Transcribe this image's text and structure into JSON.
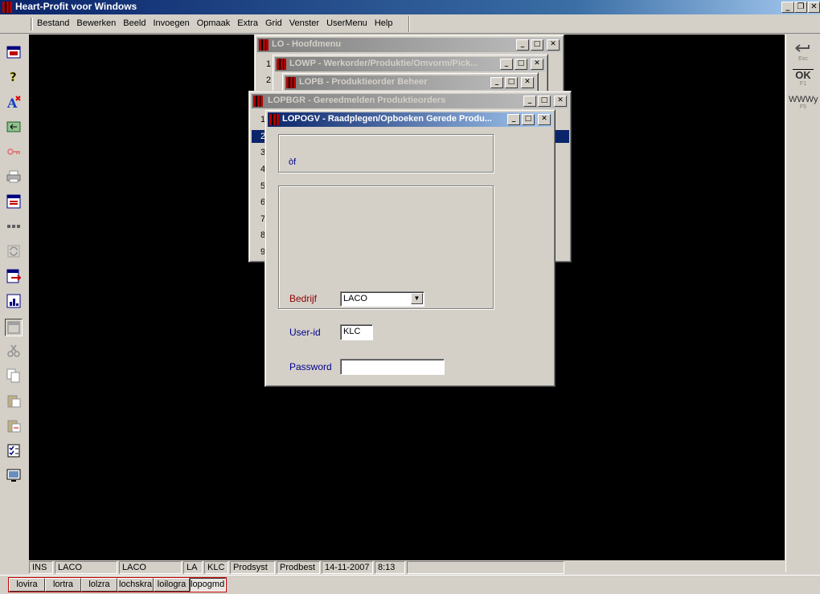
{
  "app": {
    "title": "Heart-Profit voor Windows"
  },
  "menu": [
    "Bestand",
    "Bewerken",
    "Beeld",
    "Invoegen",
    "Opmaak",
    "Extra",
    "Grid",
    "Venster",
    "UserMenu",
    "Help"
  ],
  "left_toolbar": {
    "icons": [
      "window-icon",
      "help-icon",
      "font-icon",
      "refresh-icon",
      "key-icon",
      "print-icon",
      "form-icon",
      "dots-icon",
      "sync-icon",
      "export-icon",
      "chart-icon",
      "panel-icon",
      "cut-icon",
      "copy-icon",
      "paste-icon",
      "paste-special-icon",
      "checklist-icon",
      "monitor-icon"
    ]
  },
  "right_toolbar": {
    "esc": {
      "label": "Esc",
      "icon": "back-arrow-icon"
    },
    "ok": {
      "label": "OK",
      "key": "F1"
    },
    "www": {
      "label": "WWWy",
      "key": "F5"
    }
  },
  "windows": {
    "hoofdmenu": {
      "title": "LO - Hoofdmenu",
      "rows": [
        "1",
        "2"
      ]
    },
    "lowp": {
      "title": "LOWP - Werkorder/Produktie/Omvorm/Pick..."
    },
    "lopb": {
      "title": "LOPB - Produktieorder Beheer"
    },
    "lopbgr": {
      "title": "LOPBGR - Gereedmelden Produktieorders",
      "rows": [
        "1",
        "2",
        "3",
        "4",
        "5",
        "6",
        "7",
        "8",
        "9"
      ]
    },
    "lopogv": {
      "title": "LOPOGV - Raadplegen/Opboeken Gerede Produ...",
      "header_text": "òf",
      "company_label": "Bedrijf",
      "company_value": "LACO",
      "userid_label": "User-id",
      "userid_value": "KLC",
      "password_label": "Password",
      "password_value": ""
    }
  },
  "statusbar": [
    "INS",
    "LACO",
    "LACO",
    "LA",
    "KLC",
    "Prodsyst",
    "Prodbest",
    "14-11-2007",
    "8:13",
    ""
  ],
  "taskbar": [
    "lovira",
    "lortra",
    "lolzra",
    "lochskra",
    "loilogra",
    "lopogmdl"
  ],
  "colors": {
    "title_active": "#0a246a",
    "workspace": "#000000",
    "label_red": "#8b0000",
    "label_blue": "#00008b"
  }
}
